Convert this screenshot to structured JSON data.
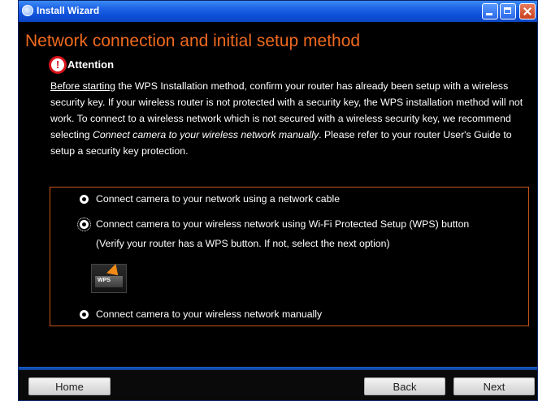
{
  "window": {
    "title": "Install Wizard"
  },
  "page": {
    "heading": "Network connection and initial setup method",
    "attention_title": "Attention",
    "paragraph": {
      "underlined": "Before starting",
      "part1": " the WPS Installation method, confirm your router has already been setup with a wireless security key. If your wireless router is not protected with a security key, the WPS installation method will not work. To connect to a wireless network which is not secured with a wireless security key, we recommend selecting ",
      "italic": "Connect camera to your wireless network manually",
      "part2": ". Please refer to your router User's Guide to setup a security key protection."
    }
  },
  "options": {
    "cable": "Connect camera to your network using a network cable",
    "wps_line1": "Connect camera to your wireless network using Wi-Fi Protected Setup (WPS) button",
    "wps_line2": "(Verify your router has a WPS button. If not, select the next option)",
    "wps_image_label": "WPS",
    "manual": "Connect camera to your wireless network manually",
    "selected": "wps"
  },
  "buttons": {
    "home": "Home",
    "back": "Back",
    "next": "Next"
  },
  "colors": {
    "accent": "#f06a1e",
    "background": "#000000",
    "titlebar": "#0d4fd8",
    "alert": "#d8131b"
  }
}
